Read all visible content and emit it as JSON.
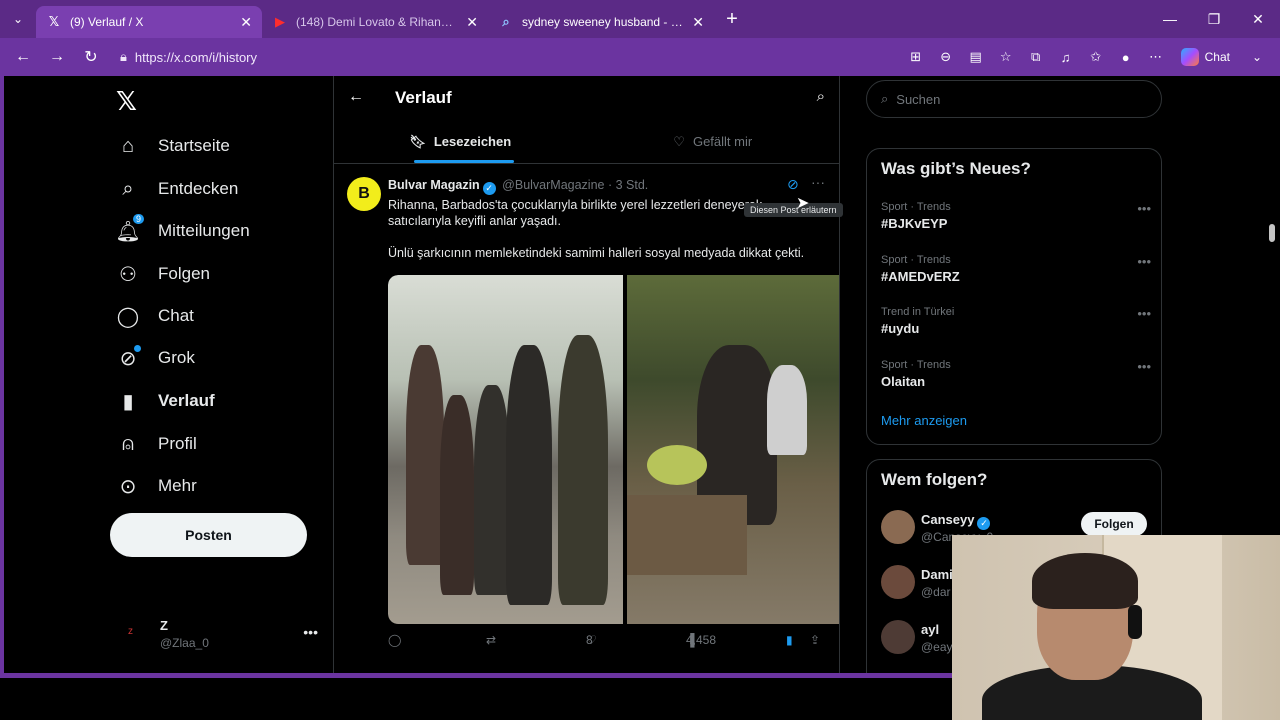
{
  "browser": {
    "tabs": [
      {
        "title": "(9) Verlauf / X",
        "favicon": "x-logo",
        "active": true
      },
      {
        "title": "(148) Demi Lovato & Rihanna - St…",
        "favicon": "youtube-logo",
        "active": false
      },
      {
        "title": "sydney sweeney husband - Suche…",
        "favicon": "search-icon",
        "active": false
      }
    ],
    "url": "https://x.com/i/history",
    "chat_label": "Chat"
  },
  "nav": {
    "items": [
      {
        "label": "Startseite",
        "icon": "home-icon"
      },
      {
        "label": "Entdecken",
        "icon": "search-icon"
      },
      {
        "label": "Mitteilungen",
        "icon": "bell-icon",
        "badge": "9"
      },
      {
        "label": "Folgen",
        "icon": "person-add-icon"
      },
      {
        "label": "Chat",
        "icon": "chat-icon"
      },
      {
        "label": "Grok",
        "icon": "grok-icon"
      },
      {
        "label": "Verlauf",
        "icon": "bookmark-icon"
      },
      {
        "label": "Profil",
        "icon": "profile-icon"
      },
      {
        "label": "Mehr",
        "icon": "more-circle-icon"
      }
    ],
    "post_label": "Posten",
    "account": {
      "name": "Z",
      "handle": "@Zlaa_0",
      "avatar_text": "z"
    }
  },
  "main": {
    "title": "Verlauf",
    "tabs": [
      {
        "label": "Lesezeichen",
        "icon": "bookmark-icon",
        "selected": true
      },
      {
        "label": "Gefällt mir",
        "icon": "heart-icon",
        "selected": false
      }
    ],
    "tweet": {
      "author": "Bulvar Magazin",
      "handle": "@BulvarMagazine",
      "time": "· 3 Std.",
      "avatar_text": "B",
      "tooltip": "Diesen Post erläutern",
      "text1": "Rihanna, Barbados'ta çocuklarıyla birlikte yerel lezzetleri deneyerek satıcılarıyla keyifli anlar yaşadı.",
      "text2": "Ünlü şarkıcının memleketindeki samimi halleri sosyal medyada dikkat çekti.",
      "likes": "8",
      "views": "4,458"
    }
  },
  "sidebar": {
    "search_placeholder": "Suchen",
    "trends_title": "Was gibt’s Neues?",
    "trends": [
      {
        "context": "Sport · Trends",
        "name": "#BJKvEYP"
      },
      {
        "context": "Sport · Trends",
        "name": "#AMEDvERZ"
      },
      {
        "context": "Trend in Türkei",
        "name": "#uydu"
      },
      {
        "context": "Sport · Trends",
        "name": "Olaitan"
      }
    ],
    "show_more": "Mehr anzeigen",
    "who_title": "Wem folgen?",
    "who": [
      {
        "name": "Canseyy",
        "handle": "@Canseyy_0",
        "follow": "Folgen"
      },
      {
        "name": "Dami",
        "handle": "@dar"
      },
      {
        "name": "ayl",
        "handle": "@eay"
      }
    ]
  },
  "colors": {
    "accent": "#1d9bf0",
    "browser": "#6b34a0",
    "background": "#000000"
  }
}
